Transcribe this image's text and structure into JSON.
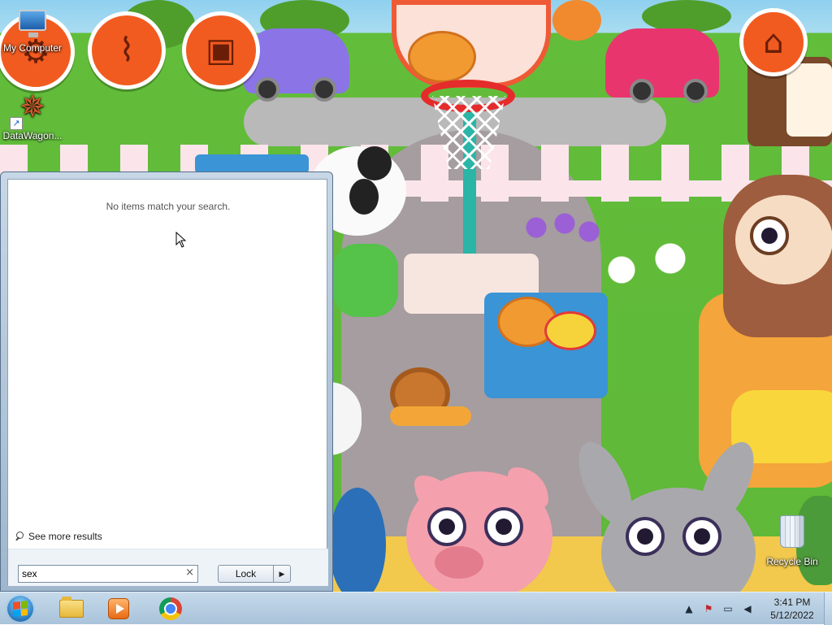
{
  "desktop": {
    "icons": [
      {
        "label": "My Computer",
        "icon": "computer-icon"
      },
      {
        "label": "DataWagon...",
        "icon": "datawagon-icon"
      },
      {
        "label": "Recycle Bin",
        "icon": "recycle-bin-icon"
      }
    ],
    "game_buttons": [
      {
        "icon": "settings-icon"
      },
      {
        "icon": "broom-icon"
      },
      {
        "icon": "sticker-album-icon"
      },
      {
        "icon": "shop-basket-icon"
      }
    ]
  },
  "start_menu": {
    "no_results_text": "No items match your search.",
    "see_more_label": "See more results",
    "search": {
      "value": "sex",
      "placeholder": ""
    },
    "power_button_label": "Lock"
  },
  "taskbar": {
    "pinned": [
      {
        "name": "Windows Explorer",
        "icon": "folder-icon"
      },
      {
        "name": "Windows Media Player",
        "icon": "media-player-icon"
      },
      {
        "name": "Google Chrome",
        "icon": "chrome-icon"
      }
    ],
    "clock": {
      "time": "3:41 PM",
      "date": "5/12/2022"
    }
  },
  "colors": {
    "game_button": "#f25b20",
    "taskbar": "#b7cde1",
    "start_orb": "#2e7fc2"
  }
}
